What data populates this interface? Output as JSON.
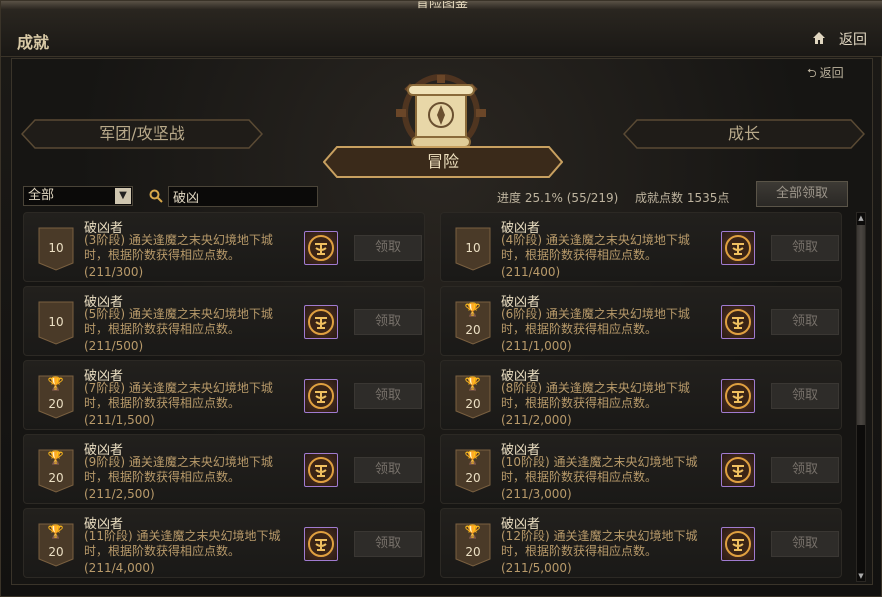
{
  "window": {
    "title": "冒险图鉴"
  },
  "header": {
    "title": "成就",
    "home_icon": "home-icon",
    "back_label": "返回"
  },
  "panel": {
    "back_label": "返回"
  },
  "tabs": [
    {
      "label": "军团/攻坚战"
    },
    {
      "label": "冒险"
    },
    {
      "label": "成长"
    }
  ],
  "filter": {
    "selected": "全部"
  },
  "search": {
    "value": "破凶"
  },
  "stats": {
    "progress": "进度  25.1% (55/219)",
    "points": "成就点数 1535点"
  },
  "claim_all_label": "全部领取",
  "achievements": [
    {
      "name": "破凶者",
      "desc": "(3阶段) 通关逢魔之末央幻境地下城时，根据阶数获得相应点数。",
      "progress": "(211/300)",
      "points": "10",
      "cup": false,
      "claim": "领取"
    },
    {
      "name": "破凶者",
      "desc": "(4阶段) 通关逢魔之末央幻境地下城时，根据阶数获得相应点数。",
      "progress": "(211/400)",
      "points": "10",
      "cup": false,
      "claim": "领取"
    },
    {
      "name": "破凶者",
      "desc": "(5阶段) 通关逢魔之末央幻境地下城时，根据阶数获得相应点数。",
      "progress": "(211/500)",
      "points": "10",
      "cup": false,
      "claim": "领取"
    },
    {
      "name": "破凶者",
      "desc": "(6阶段) 通关逢魔之末央幻境地下城时，根据阶数获得相应点数。",
      "progress": "(211/1,000)",
      "points": "20",
      "cup": true,
      "claim": "领取"
    },
    {
      "name": "破凶者",
      "desc": "(7阶段) 通关逢魔之末央幻境地下城时，根据阶数获得相应点数。",
      "progress": "(211/1,500)",
      "points": "20",
      "cup": true,
      "claim": "领取"
    },
    {
      "name": "破凶者",
      "desc": "(8阶段) 通关逢魔之末央幻境地下城时，根据阶数获得相应点数。",
      "progress": "(211/2,000)",
      "points": "20",
      "cup": true,
      "claim": "领取"
    },
    {
      "name": "破凶者",
      "desc": "(9阶段) 通关逢魔之末央幻境地下城时，根据阶数获得相应点数。",
      "progress": "(211/2,500)",
      "points": "20",
      "cup": true,
      "claim": "领取"
    },
    {
      "name": "破凶者",
      "desc": "(10阶段) 通关逢魔之末央幻境地下城时，根据阶数获得相应点数。",
      "progress": "(211/3,000)",
      "points": "20",
      "cup": true,
      "claim": "领取"
    },
    {
      "name": "破凶者",
      "desc": "(11阶段) 通关逢魔之末央幻境地下城时，根据阶数获得相应点数。",
      "progress": "(211/4,000)",
      "points": "20",
      "cup": true,
      "claim": "领取"
    },
    {
      "name": "破凶者",
      "desc": "(12阶段) 通关逢魔之末央幻境地下城时，根据阶数获得相应点数。",
      "progress": "(211/5,000)",
      "points": "20",
      "cup": true,
      "claim": "领取"
    }
  ],
  "colors": {
    "gold": "#d8a84a",
    "text": "#d8c9a6",
    "desc": "#b89a6a",
    "reward_border": "#a07bd0"
  }
}
